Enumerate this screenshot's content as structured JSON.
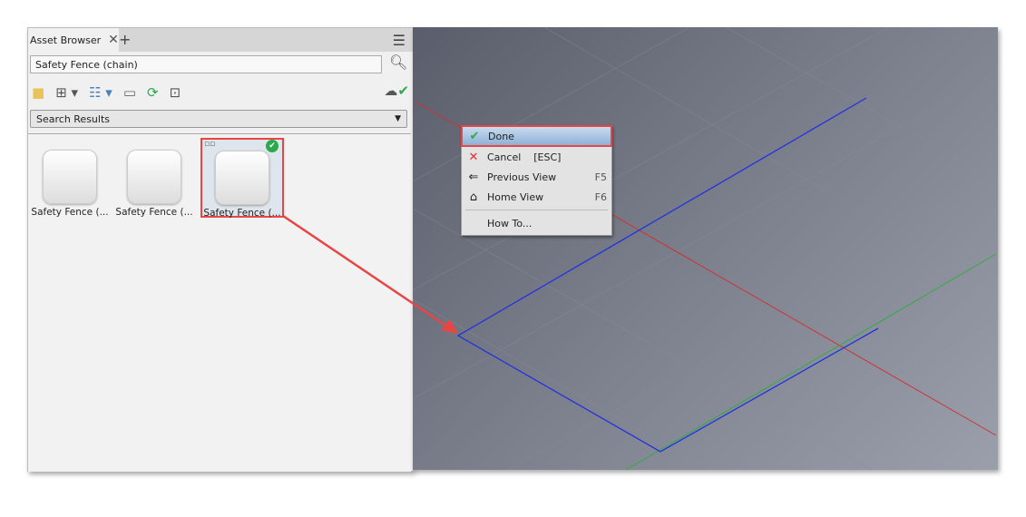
{
  "panel": {
    "tab_label": "Asset Browser",
    "search_value": "Safety Fence (chain)",
    "filter_select": "Search Results",
    "items": [
      {
        "label": "Safety Fence (..."
      },
      {
        "label": "Safety Fence (..."
      },
      {
        "label": "Safety Fence (..."
      }
    ]
  },
  "context_menu": {
    "items": [
      {
        "label": "Done"
      },
      {
        "label": "Cancel",
        "shortcut": "[ESC]"
      },
      {
        "label": "Previous View",
        "shortcut": "F5"
      },
      {
        "label": "Home View",
        "shortcut": "F6"
      },
      {
        "label": "How To..."
      }
    ]
  },
  "colors": {
    "accent": "#e84545",
    "axis_blue": "#2233dd",
    "axis_red": "#cc3333",
    "axis_green": "#33aa44"
  }
}
